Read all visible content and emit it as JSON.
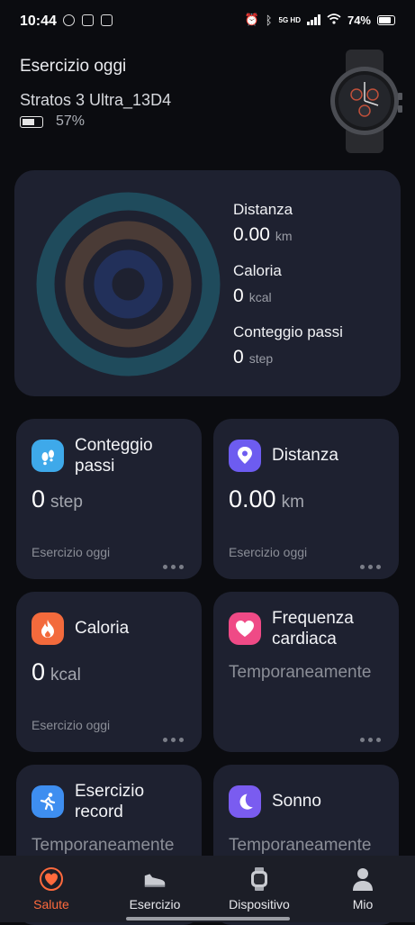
{
  "status": {
    "time": "10:44",
    "network": "5G HD",
    "battery": "74%"
  },
  "header": {
    "title": "Esercizio oggi",
    "device": "Stratos 3 Ultra_13D4",
    "device_battery": "57%"
  },
  "summary": {
    "distance": {
      "label": "Distanza",
      "value": "0.00",
      "unit": "km"
    },
    "calories": {
      "label": "Caloria",
      "value": "0",
      "unit": "kcal"
    },
    "steps": {
      "label": "Conteggio passi",
      "value": "0",
      "unit": "step"
    },
    "ring_colors": [
      "#1f4b5c",
      "#4a3b36",
      "#22305a"
    ]
  },
  "cards": {
    "steps": {
      "name": "Conteggio passi",
      "value": "0",
      "unit": "step",
      "sub": "Esercizio oggi",
      "icon": "footprints-icon",
      "color": "#3ea9ea"
    },
    "distance": {
      "name": "Distanza",
      "value": "0.00",
      "unit": "km",
      "sub": "Esercizio oggi",
      "icon": "location-pin-icon",
      "color": "#6d5cf0"
    },
    "calories": {
      "name": "Caloria",
      "value": "0",
      "unit": "kcal",
      "sub": "Esercizio oggi",
      "icon": "flame-icon",
      "color": "#f36a3c"
    },
    "heart": {
      "name": "Frequenza cardiaca",
      "temp": "Temporaneamente",
      "icon": "heart-icon",
      "color": "#ef4a86"
    },
    "record": {
      "name": "Esercizio record",
      "temp": "Temporaneamente",
      "icon": "running-icon",
      "color": "#3e8ef0"
    },
    "sleep": {
      "name": "Sonno",
      "temp": "Temporaneamente",
      "icon": "moon-icon",
      "color": "#7a5cf0"
    }
  },
  "nav": {
    "tabs": [
      "Salute",
      "Esercizio",
      "Dispositivo",
      "Mio"
    ],
    "active_color": "#ff6a3d"
  }
}
